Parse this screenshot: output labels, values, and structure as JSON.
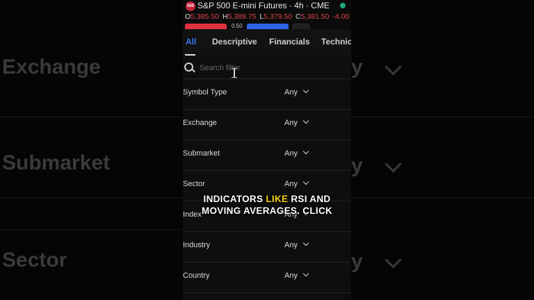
{
  "header": {
    "logo_text": "500",
    "title": "S&P 500 E-mini Futures · 4h · CME",
    "ohlc": [
      {
        "label": "O",
        "value": "5,385.50"
      },
      {
        "label": "H",
        "value": "5,389.75"
      },
      {
        "label": "L",
        "value": "5,379.50"
      },
      {
        "label": "C",
        "value": "5,381.50"
      }
    ],
    "change": "-4.00",
    "spread": "0.50",
    "colors": {
      "down": "#e0424b",
      "sell": "#e0313f",
      "buy": "#2d63e8",
      "live": "#1fa97a"
    }
  },
  "tabs": [
    "All",
    "Descriptive",
    "Financials",
    "Technica"
  ],
  "active_tab": "All",
  "search": {
    "placeholder": "Search filter",
    "value": ""
  },
  "filters": [
    {
      "label": "Symbol Type",
      "value": "Any"
    },
    {
      "label": "Exchange",
      "value": "Any"
    },
    {
      "label": "Submarket",
      "value": "Any"
    },
    {
      "label": "Sector",
      "value": "Any"
    },
    {
      "label": "Index",
      "value": "Any"
    },
    {
      "label": "Industry",
      "value": "Any"
    },
    {
      "label": "Country",
      "value": "Any"
    }
  ],
  "caption": {
    "line1_pre": "INDICATORS ",
    "line1_highlight": "LIKE",
    "line1_post": " RSI AND",
    "line2": "MOVING AVERAGES. CLICK",
    "highlight_color": "#f3d11d"
  },
  "background": {
    "labels": [
      "Exchange",
      "Submarket",
      "Sector"
    ],
    "right_text": "y"
  }
}
